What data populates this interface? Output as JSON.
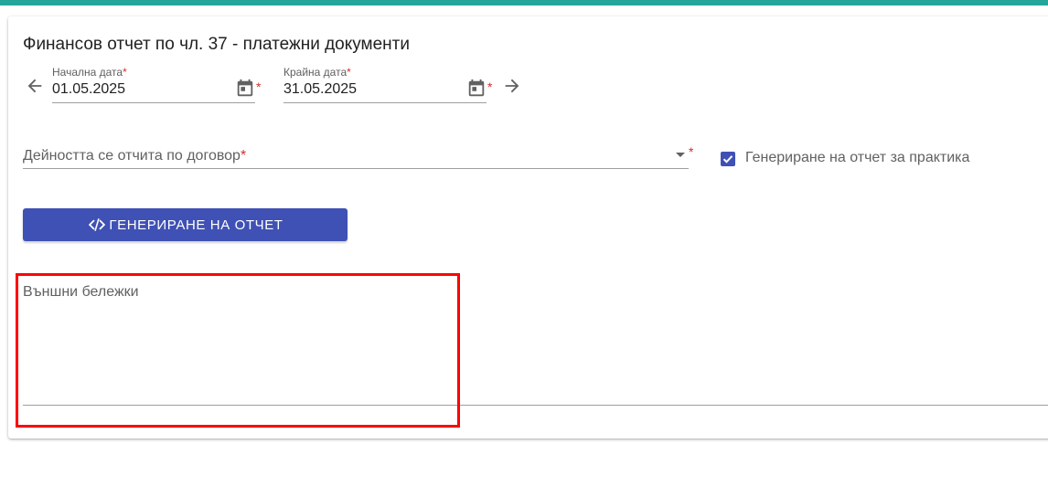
{
  "page": {
    "title": "Финансов отчет по чл. 37 - платежни документи"
  },
  "start_date": {
    "label": "Начална дата",
    "required_mark": "*",
    "value": "01.05.2025"
  },
  "end_date": {
    "label": "Крайна дата",
    "required_mark": "*",
    "value": "31.05.2025"
  },
  "contract_select": {
    "placeholder": "Дейността се отчита по договор",
    "required_mark": "*"
  },
  "practice_checkbox": {
    "label": "Генериране на отчет за практика",
    "checked": true
  },
  "generate_button": {
    "label": "ГЕНЕРИРАНЕ НА ОТЧЕТ",
    "icon": "code-icon"
  },
  "notes": {
    "label": "Външни бележки",
    "value": ""
  },
  "icons": {
    "prev": "arrow-left-icon",
    "next": "arrow-right-icon",
    "calendar": "calendar-icon",
    "dropdown": "chevron-down-icon"
  },
  "colors": {
    "accent_bar": "#26a69a",
    "primary": "#3f51b5",
    "required": "#d32f2f",
    "highlight": "#ff0000"
  }
}
